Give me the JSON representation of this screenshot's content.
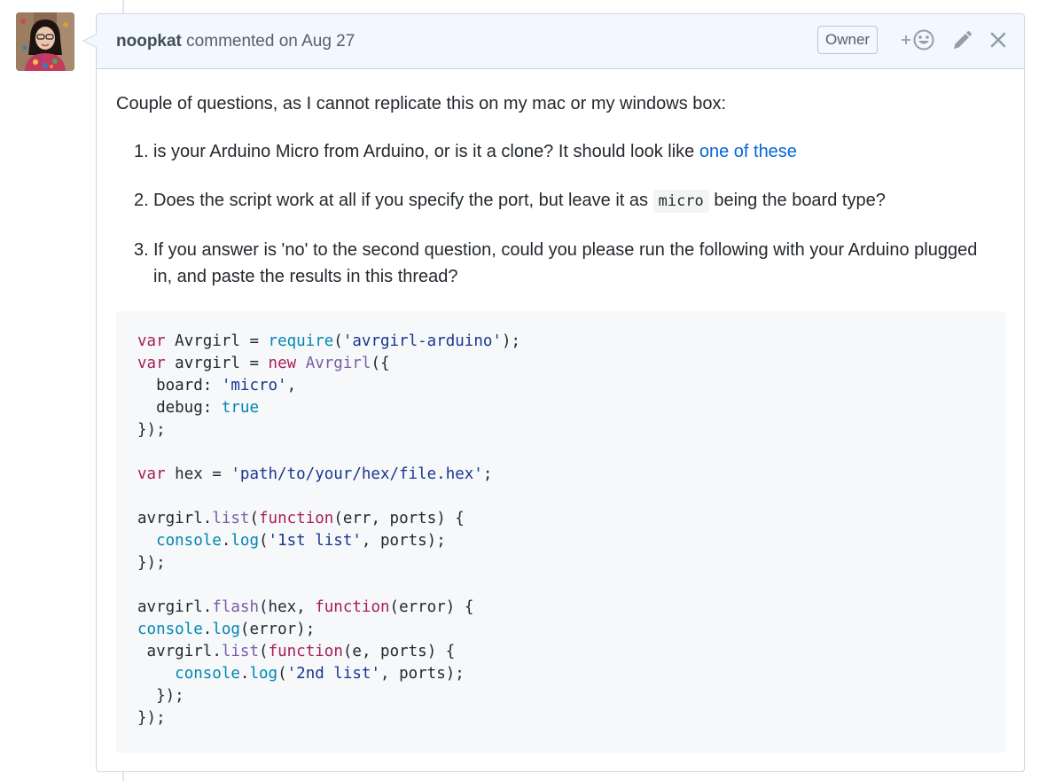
{
  "comment": {
    "author": "noopkat",
    "action_text": " commented on Aug 27",
    "badge": "Owner",
    "icons": {
      "reaction": "add-reaction-icon",
      "edit": "pencil-icon",
      "close": "close-icon"
    }
  },
  "body": {
    "intro": "Couple of questions, as I cannot replicate this on my mac or my windows box:",
    "questions": [
      {
        "number": "1.",
        "text": "is your Arduino Micro from Arduino, or is it a clone? It should look like ",
        "link_text": "one of these"
      },
      {
        "number": "2.",
        "text_before": "Does the script work at all if you specify the port, but leave it as ",
        "code": "micro",
        "text_after": " being the board type?"
      },
      {
        "number": "3.",
        "text": "If you answer is 'no' to the second question, could you please run the following with your Arduino plugged in, and paste the results in this thread?"
      }
    ]
  },
  "code_lines": [
    "var Avrgirl = require('avrgirl-arduino');",
    "var avrgirl = new Avrgirl({",
    "  board: 'micro',",
    "  debug: true",
    "});",
    "",
    "var hex = 'path/to/your/hex/file.hex';",
    "",
    "avrgirl.list(function(err, ports) {",
    "  console.log('1st list', ports);",
    "});",
    "",
    "avrgirl.flash(hex, function(error) {",
    "console.log(error);",
    " avrgirl.list(function(e, ports) {",
    "    console.log('2nd list', ports);",
    "  });",
    "});"
  ],
  "colors": {
    "keyword": "#a71d5d",
    "function": "#795da3",
    "builtin": "#0086b3",
    "string": "#183691",
    "link": "#0366d6",
    "header_bg": "#f1f8ff"
  }
}
